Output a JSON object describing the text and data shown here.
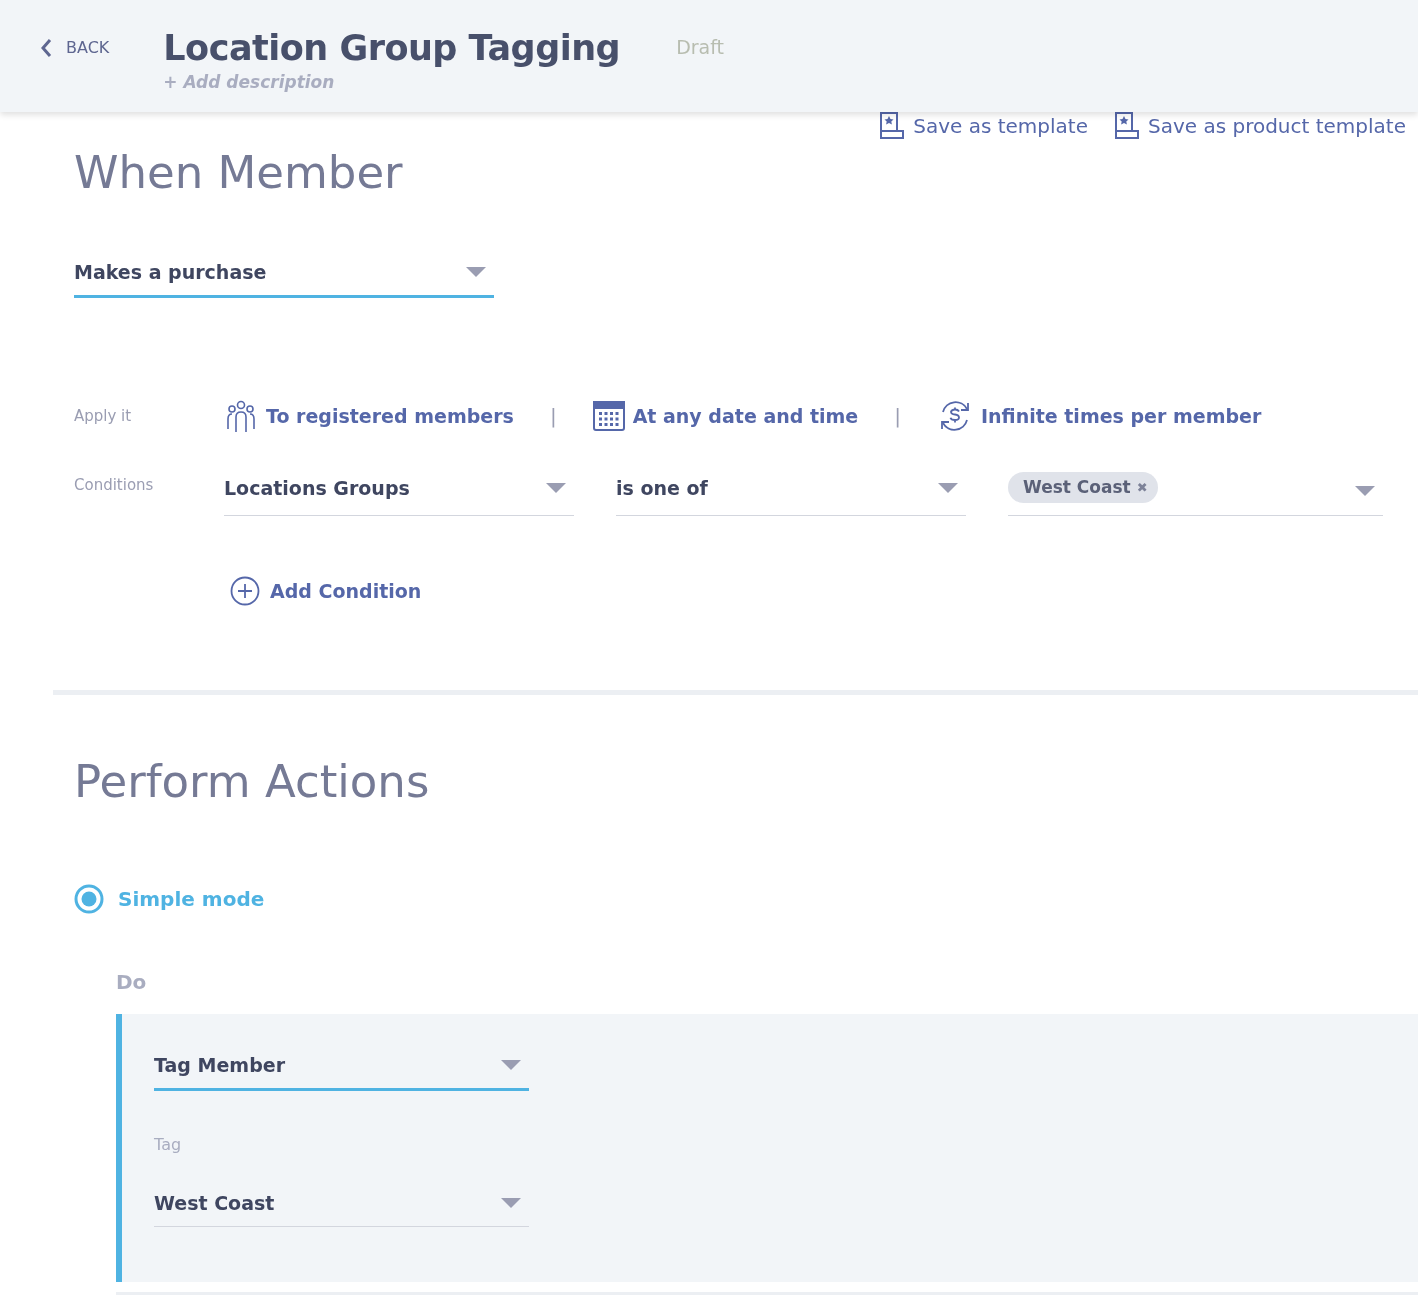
{
  "header": {
    "back": "BACK",
    "title": "Location Group Tagging",
    "status": "Draft",
    "description": "+ Add description"
  },
  "template_links": [
    {
      "label": "Save as template"
    },
    {
      "label": "Save as product template"
    }
  ],
  "when_member": {
    "heading": "When Member",
    "trigger": {
      "value": "Makes a purchase",
      "focused": true
    }
  },
  "apply_it": {
    "label": "Apply it",
    "options": [
      {
        "kind": "members",
        "label": "To registered members"
      },
      {
        "kind": "date",
        "label": "At any date and time"
      },
      {
        "kind": "repeat",
        "label": "Infinite times per member"
      }
    ],
    "separator": "|"
  },
  "conditions": {
    "label": "Conditions",
    "field": {
      "value": "Locations Groups",
      "focused": false
    },
    "operator": {
      "value": "is one of",
      "focused": false
    },
    "values": [
      {
        "label": "West Coast",
        "remove": "✖"
      }
    ],
    "add_label": "Add Condition"
  },
  "perform_actions": {
    "heading": "Perform Actions",
    "modes": [
      {
        "label": "Simple mode",
        "selected": true
      }
    ],
    "do_label": "Do",
    "action": {
      "type": {
        "value": "Tag Member",
        "focused": true
      },
      "tag_label": "Tag",
      "tag": {
        "value": "West Coast",
        "focused": false
      }
    }
  }
}
